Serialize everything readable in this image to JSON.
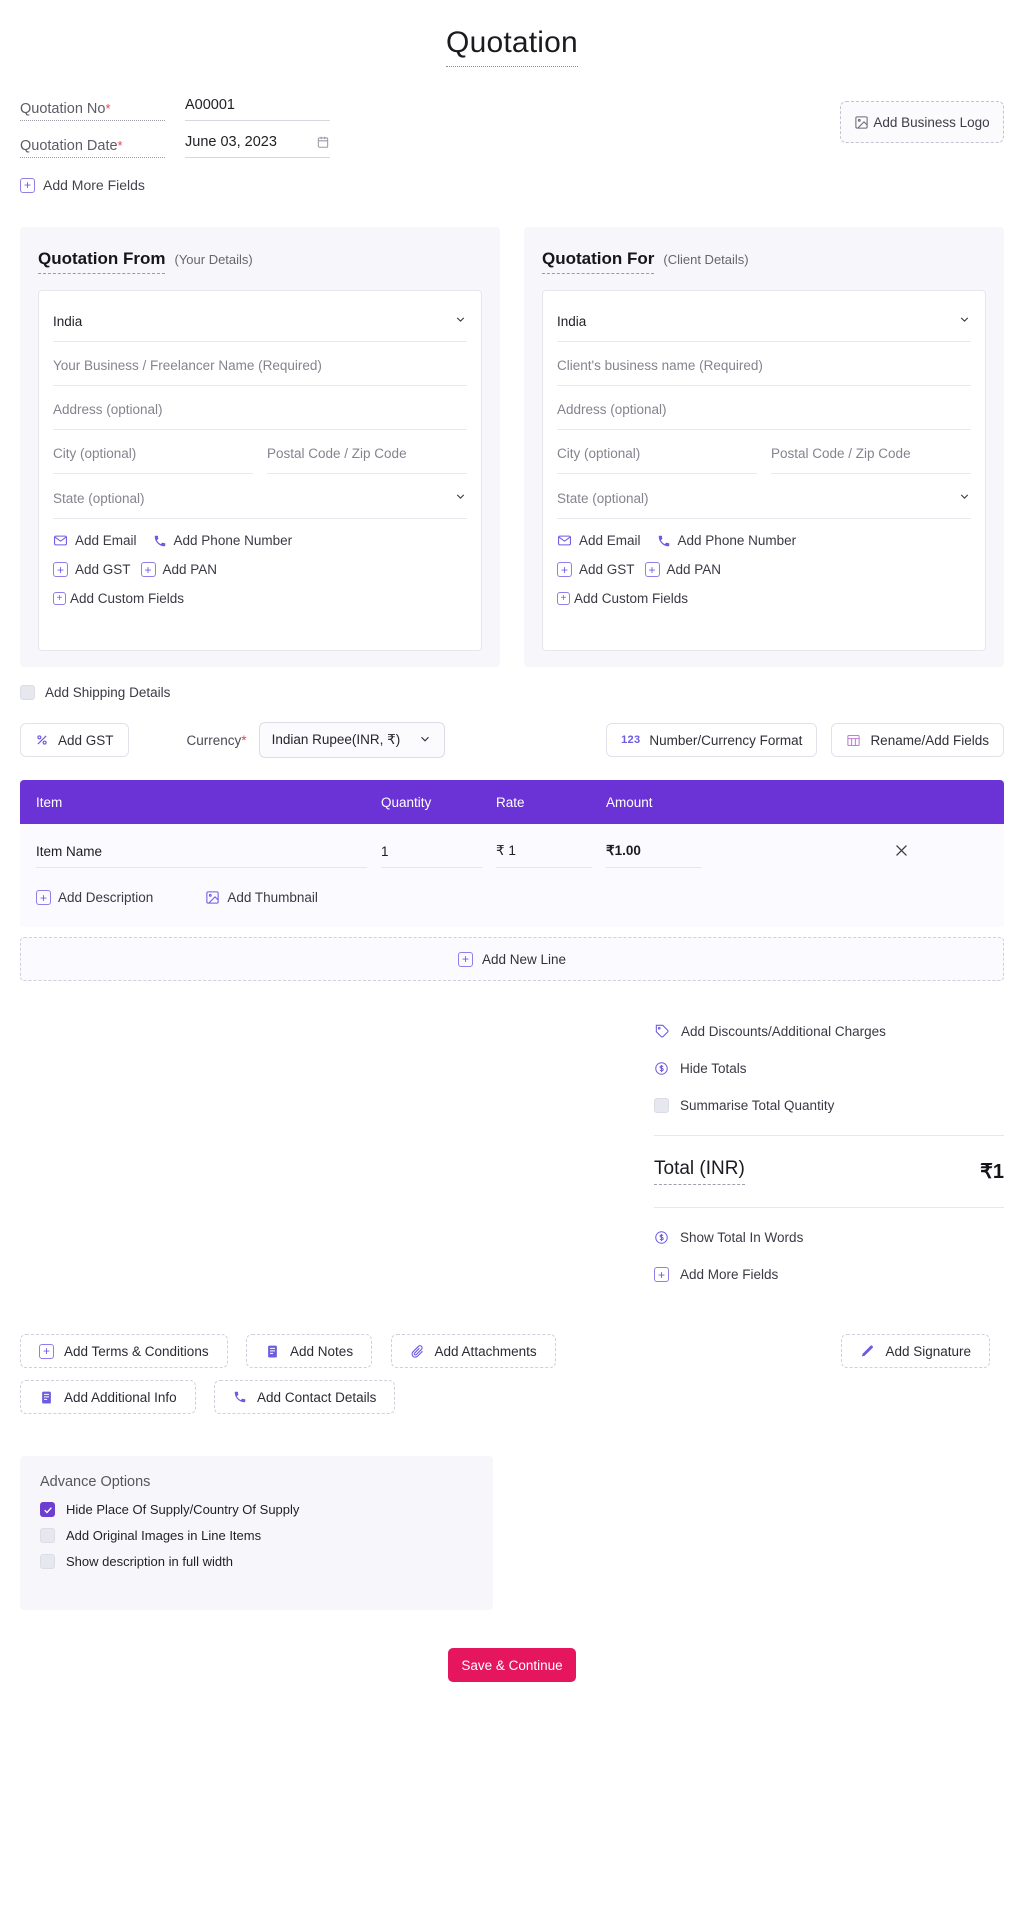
{
  "document": {
    "title": "Quotation"
  },
  "meta": {
    "quotation_no_label": "Quotation No",
    "quotation_no_value": "A00001",
    "quotation_date_label": "Quotation Date",
    "quotation_date_value": "June 03, 2023",
    "required_mark": "*",
    "add_more_fields": "Add More Fields",
    "calendar_icon": "calendar-icon"
  },
  "logo": {
    "label": "Add Business Logo",
    "icon": "image-icon"
  },
  "party_from": {
    "title": "Quotation From",
    "subtitle": "(Your Details)",
    "country": "India",
    "business_name_placeholder": "Your Business / Freelancer Name (Required)",
    "address_placeholder": "Address (optional)",
    "city_placeholder": "City (optional)",
    "postal_placeholder": "Postal Code / Zip Code",
    "state_placeholder": "State (optional)",
    "add_email": "Add Email",
    "add_phone": "Add Phone Number",
    "add_gst": "Add GST",
    "add_pan": "Add PAN",
    "add_custom_fields": "Add Custom Fields"
  },
  "party_for": {
    "title": "Quotation For",
    "subtitle": "(Client Details)",
    "country": "India",
    "business_name_placeholder": "Client's business name (Required)",
    "address_placeholder": "Address (optional)",
    "city_placeholder": "City (optional)",
    "postal_placeholder": "Postal Code / Zip Code",
    "state_placeholder": "State (optional)",
    "add_email": "Add Email",
    "add_phone": "Add Phone Number",
    "add_gst": "Add GST",
    "add_pan": "Add PAN",
    "add_custom_fields": "Add Custom Fields"
  },
  "shipping": {
    "label": "Add Shipping Details",
    "checked": false
  },
  "toolbar": {
    "add_gst": "Add GST",
    "percent_icon": "percent-icon",
    "currency_label": "Currency",
    "currency_required": "*",
    "currency_value": "Indian Rupee(INR, ₹)",
    "number_format": "Number/Currency Format",
    "number_format_icon": "123",
    "rename_add_fields": "Rename/Add Fields",
    "table-icon": "table-icon"
  },
  "items_table": {
    "columns": [
      "Item",
      "Quantity",
      "Rate",
      "Amount"
    ],
    "rows": [
      {
        "item": "Item Name",
        "quantity": "1",
        "rate": "₹ 1",
        "amount": "₹1.00",
        "delete_icon": "close-icon"
      }
    ],
    "add_description": "Add Description",
    "add_thumbnail": "Add Thumbnail",
    "add_new_line": "Add New Line",
    "header_color": "#6b33d6"
  },
  "totals": {
    "add_discounts": "Add Discounts/Additional Charges",
    "hide_totals": "Hide Totals",
    "summarise_total_quantity": "Summarise Total Quantity",
    "summarise_checked": false,
    "total_label": "Total (INR)",
    "total_value": "₹1",
    "show_total_in_words": "Show Total In Words",
    "add_more_fields": "Add More Fields"
  },
  "doc_actions": [
    {
      "label": "Add Terms & Conditions",
      "icon": "plus-icon"
    },
    {
      "label": "Add Notes",
      "icon": "notes-icon"
    },
    {
      "label": "Add Attachments",
      "icon": "paperclip-icon"
    },
    {
      "label": "Add Additional Info",
      "icon": "notes-icon"
    },
    {
      "label": "Add Contact Details",
      "icon": "phone-icon"
    }
  ],
  "signature": {
    "label": "Add Signature",
    "icon": "pen-icon"
  },
  "advance_options": {
    "title": "Advance Options",
    "items": [
      {
        "label": "Hide Place Of Supply/Country Of Supply",
        "checked": true
      },
      {
        "label": "Add Original Images in Line Items",
        "checked": false
      },
      {
        "label": "Show description in full width",
        "checked": false
      }
    ]
  },
  "footer": {
    "save_label": "Save & Continue",
    "save_color": "#e5165e"
  }
}
